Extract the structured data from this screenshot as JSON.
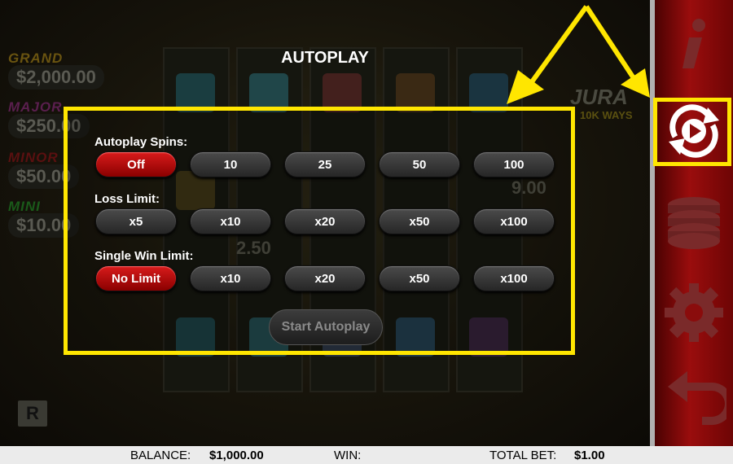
{
  "title": "AUTOPLAY",
  "autoplay_spins": {
    "label": "Autoplay Spins:",
    "options": [
      "Off",
      "10",
      "25",
      "50",
      "100"
    ],
    "selected": "Off"
  },
  "loss_limit": {
    "label": "Loss Limit:",
    "options": [
      "x5",
      "x10",
      "x20",
      "x50",
      "x100"
    ]
  },
  "single_win_limit": {
    "label": "Single Win Limit:",
    "options": [
      "No Limit",
      "x10",
      "x20",
      "x50",
      "x100"
    ],
    "selected": "No Limit"
  },
  "start_button": "Start Autoplay",
  "background": {
    "jackpots": [
      {
        "name": "GRAND",
        "amount": "$2,000.00",
        "color": "#b08a10"
      },
      {
        "name": "MAJOR",
        "amount": "$250.00",
        "color": "#a03a8a"
      },
      {
        "name": "MINOR",
        "amount": "$50.00",
        "color": "#a01818"
      },
      {
        "name": "MINI",
        "amount": "$10.00",
        "color": "#2a8a2a"
      }
    ],
    "ghost_values": [
      "9.00",
      "2.50"
    ],
    "game_logo_text": "JURA",
    "game_logo_sub": "10K WAYS",
    "brand_icon": "R"
  },
  "sidebar": {
    "icons": [
      "info-icon",
      "autoplay-icon",
      "chips-icon",
      "gear-icon",
      "back-arrow-icon"
    ]
  },
  "status_bar": {
    "balance_label": "BALANCE:",
    "balance_value": "$1,000.00",
    "win_label": "WIN:",
    "win_value": "",
    "total_bet_label": "TOTAL BET:",
    "total_bet_value": "$1.00"
  },
  "colors": {
    "highlight": "#ffe600",
    "selected": "#c40f0f",
    "sidebar": "#9a0d0d"
  }
}
